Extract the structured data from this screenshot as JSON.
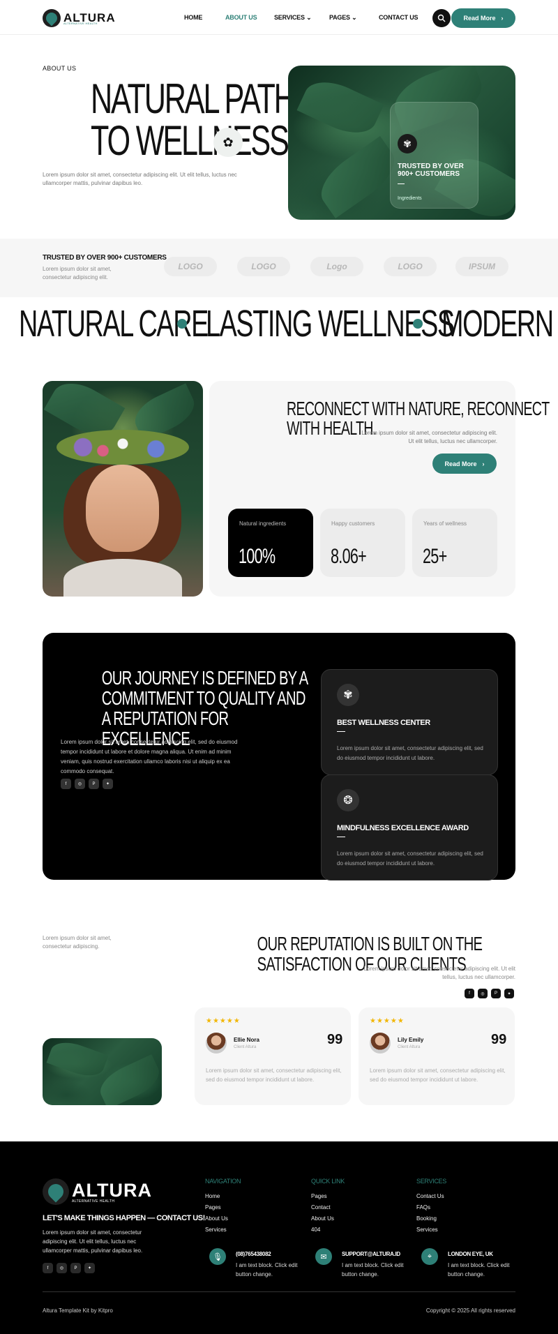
{
  "header": {
    "logo_text": "ALTURA",
    "logo_sub": "ALTERNATIVE HEALTH",
    "nav": [
      "HOME",
      "ABOUT US",
      "SERVICES",
      "PAGES",
      "CONTACT US"
    ],
    "cta": "Read More"
  },
  "hero": {
    "tag": "ABOUT US",
    "title_line1": "NATURAL PATHS",
    "title_line2": "TO WELLNESS",
    "desc": "Lorem ipsum dolor sit amet, consectetur adipiscing elit. Ut elit tellus, luctus nec ullamcorper mattis, pulvinar dapibus leo.",
    "card_title": "TRUSTED BY OVER 900+ CUSTOMERS",
    "card_sub": "Ingredients"
  },
  "trust": {
    "title": "TRUSTED BY OVER 900+ CUSTOMERS",
    "desc": "Lorem ipsum dolor sit amet, consectetur adipiscing elit.",
    "logos": [
      "LOGO",
      "LOGO",
      "Logo",
      "LOGO",
      "IPSUM"
    ]
  },
  "marquee": [
    "NATURAL CARE",
    "LASTING WELLNESS",
    "MODERN WELLNESS"
  ],
  "about": {
    "title": "RECONNECT WITH NATURE, RECONNECT WITH HEALTH.",
    "desc": "Lorem ipsum dolor sit amet, consectetur adipiscing elit. Ut elit tellus, luctus nec ullamcorper.",
    "cta": "Read More",
    "stats": [
      {
        "label": "Natural ingredients",
        "value": "100%"
      },
      {
        "label": "Happy customers",
        "value": "8.06+"
      },
      {
        "label": "Years of wellness",
        "value": "25+"
      }
    ]
  },
  "journey": {
    "title": "OUR JOURNEY IS DEFINED BY A COMMITMENT TO QUALITY AND A REPUTATION FOR EXCELLENCE",
    "desc": "Lorem ipsum dolor sit amet, consectetur adipiscing elit, sed do eiusmod tempor incididunt ut labore et dolore magna aliqua. Ut enim ad minim veniam, quis nostrud exercitation ullamco laboris nisi ut aliquip ex ea commodo consequat.",
    "awards": [
      {
        "title": "BEST WELLNESS CENTER",
        "desc": "Lorem ipsum dolor sit amet, consectetur adipiscing elit, sed do eiusmod tempor incididunt ut labore."
      },
      {
        "title": "MINDFULNESS EXCELLENCE AWARD",
        "desc": "Lorem ipsum dolor sit amet, consectetur adipiscing elit, sed do eiusmod tempor incididunt ut labore."
      }
    ]
  },
  "reputation": {
    "note": "Lorem ipsum dolor sit amet, consectetur adipiscing.",
    "title": "OUR REPUTATION IS BUILT ON THE SATISFACTION OF OUR CLIENTS",
    "desc": "Lorem ipsum dolor sit amet, consectetur adipiscing elit. Ut elit tellus, luctus nec ullamcorper.",
    "reviews": [
      {
        "stars": "★★★★★",
        "name": "Ellie Nora",
        "role": "Client Altura",
        "text": "Lorem ipsum dolor sit amet, consectetur adipiscing elit, sed do eiusmod tempor incididunt ut labore."
      },
      {
        "stars": "★★★★★",
        "name": "Lily Emily",
        "role": "Client Altura",
        "text": "Lorem ipsum dolor sit amet, consectetur adipiscing elit, sed do eiusmod tempor incididunt ut labore."
      }
    ]
  },
  "footer": {
    "logo_text": "ALTURA",
    "logo_sub": "ALTERNATIVE HEALTH",
    "tagline": "LET'S MAKE THINGS HAPPEN — CONTACT US!",
    "desc": "Lorem ipsum dolor sit amet, consectetur adipiscing elit. Ut elit tellus, luctus nec ullamcorper mattis, pulvinar dapibus leo.",
    "columns": [
      {
        "title": "NAVIGATION",
        "items": [
          "Home",
          "Pages",
          "About Us",
          "Services"
        ]
      },
      {
        "title": "QUICK LINK",
        "items": [
          "Pages",
          "Contact",
          "About Us",
          "404"
        ]
      },
      {
        "title": "SERVICES",
        "items": [
          "Contact Us",
          "FAQs",
          "Booking",
          "Services"
        ]
      }
    ],
    "contacts": [
      {
        "title": "(08)765438082",
        "text": "I am text block. Click edit button change."
      },
      {
        "title": "SUPPORT@ALTURA.ID",
        "text": "I am text block. Click edit button change."
      },
      {
        "title": "LONDON EYE, UK",
        "text": "I am text block. Click edit button change."
      }
    ],
    "copy_left": "Altura Template Kit by Kitpro",
    "copy_right": "Copyright © 2025 All rights reserved"
  },
  "colors": {
    "accent": "#2e8077",
    "dark": "#000000",
    "light": "#f6f6f6"
  }
}
